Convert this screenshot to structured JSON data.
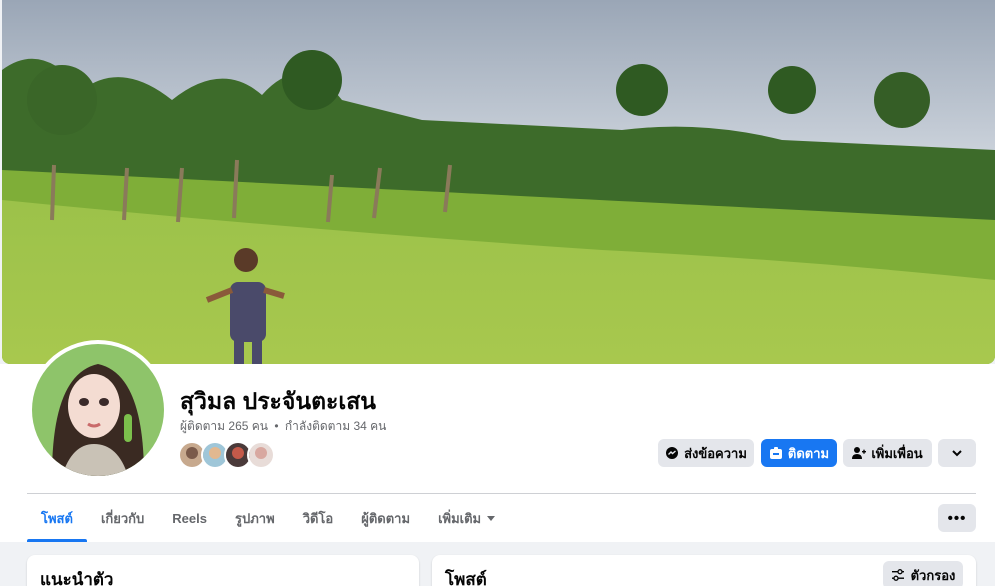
{
  "profile": {
    "name": "สุวิมล ประจันตะเสน",
    "followers": "ผู้ติดตาม 265 คน",
    "separator": "•",
    "following": "กำลังติดตาม 34 คน"
  },
  "actions": {
    "message": "ส่งข้อความ",
    "follow": "ติดตาม",
    "add_friend": "เพิ่มเพื่อน",
    "more_icon": "chevron-down-icon"
  },
  "tabs": [
    {
      "label": "โพสต์",
      "active": true
    },
    {
      "label": "เกี่ยวกับ",
      "active": false
    },
    {
      "label": "Reels",
      "active": false
    },
    {
      "label": "รูปภาพ",
      "active": false
    },
    {
      "label": "วิดีโอ",
      "active": false
    },
    {
      "label": "ผู้ติดตาม",
      "active": false
    },
    {
      "label": "เพิ่มเติม",
      "active": false
    }
  ],
  "tab_more_label": "•••",
  "intro_card": {
    "title": "แนะนำตัว"
  },
  "posts_card": {
    "title": "โพสต์",
    "filter_label": "ตัวกรอง"
  },
  "colors": {
    "accent": "#1877f2",
    "button_grey": "#e4e6eb",
    "background": "#f0f2f5",
    "secondary_text": "#65676b"
  }
}
